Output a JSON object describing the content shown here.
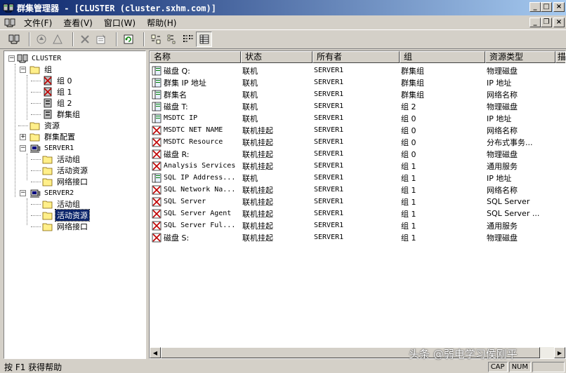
{
  "window": {
    "title": "群集管理器 - [CLUSTER (cluster.sxhm.com)]",
    "min_glyph": "_",
    "max_glyph": "□",
    "close_glyph": "×",
    "restore_glyph": "❐"
  },
  "menu": [
    "文件(F)",
    "查看(V)",
    "窗口(W)",
    "帮助(H)"
  ],
  "toolbar": {
    "buttons": [
      "cluster-icon",
      "bring-online-icon",
      "take-offline-icon",
      "delete-icon",
      "properties-icon",
      "refresh-icon",
      "large-icons-icon",
      "small-icons-icon",
      "list-icon",
      "details-icon"
    ]
  },
  "tree": {
    "cluster": "CLUSTER",
    "groups": "组",
    "group0": "组 0",
    "group1": "组 1",
    "group2": "组 2",
    "cluster_group": "群集组",
    "resources": "资源",
    "cluster_config": "群集配置",
    "server1": "SERVER1",
    "s1_active_groups": "活动组",
    "s1_active_resources": "活动资源",
    "s1_net_interfaces": "网络接口",
    "server2": "SERVER2",
    "s2_active_groups": "活动组",
    "s2_active_resources": "活动资源",
    "s2_net_interfaces": "网络接口"
  },
  "list": {
    "columns": [
      "名称",
      "状态",
      "所有者",
      "组",
      "资源类型",
      "描"
    ],
    "rows": [
      {
        "icon": "online",
        "name": "磁盘 Q:",
        "state": "联机",
        "owner": "SERVER1",
        "group": "群集组",
        "type": "物理磁盘"
      },
      {
        "icon": "online",
        "name": "群集 IP 地址",
        "state": "联机",
        "owner": "SERVER1",
        "group": "群集组",
        "type": "IP 地址"
      },
      {
        "icon": "online",
        "name": "群集名",
        "state": "联机",
        "owner": "SERVER1",
        "group": "群集组",
        "type": "网络名称"
      },
      {
        "icon": "online",
        "name": "磁盘 T:",
        "state": "联机",
        "owner": "SERVER1",
        "group": "组 2",
        "type": "物理磁盘"
      },
      {
        "icon": "online",
        "name": "MSDTC IP",
        "state": "联机",
        "owner": "SERVER1",
        "group": "组 0",
        "type": "IP 地址"
      },
      {
        "icon": "pending",
        "name": "MSDTC NET NAME",
        "state": "联机挂起",
        "owner": "SERVER1",
        "group": "组 0",
        "type": "网络名称"
      },
      {
        "icon": "pending",
        "name": "MSDTC Resource",
        "state": "联机挂起",
        "owner": "SERVER1",
        "group": "组 0",
        "type": "分布式事务..."
      },
      {
        "icon": "pending",
        "name": "磁盘 R:",
        "state": "联机挂起",
        "owner": "SERVER1",
        "group": "组 0",
        "type": "物理磁盘"
      },
      {
        "icon": "pending",
        "name": "Analysis Services",
        "state": "联机挂起",
        "owner": "SERVER1",
        "group": "组 1",
        "type": "通用服务"
      },
      {
        "icon": "online",
        "name": "SQL IP Address...",
        "state": "联机",
        "owner": "SERVER1",
        "group": "组 1",
        "type": "IP 地址"
      },
      {
        "icon": "pending",
        "name": "SQL Network Na...",
        "state": "联机挂起",
        "owner": "SERVER1",
        "group": "组 1",
        "type": "网络名称"
      },
      {
        "icon": "pending",
        "name": "SQL Server",
        "state": "联机挂起",
        "owner": "SERVER1",
        "group": "组 1",
        "type": "SQL Server"
      },
      {
        "icon": "pending",
        "name": "SQL Server Agent",
        "state": "联机挂起",
        "owner": "SERVER1",
        "group": "组 1",
        "type": "SQL Server ..."
      },
      {
        "icon": "pending",
        "name": "SQL Server Ful...",
        "state": "联机挂起",
        "owner": "SERVER1",
        "group": "组 1",
        "type": "通用服务"
      },
      {
        "icon": "pending",
        "name": "磁盘 S:",
        "state": "联机挂起",
        "owner": "SERVER1",
        "group": "组 1",
        "type": "物理磁盘"
      }
    ]
  },
  "status": {
    "text": "按 F1 获得帮助",
    "caps": "CAP",
    "num": "NUM"
  },
  "watermark": "头条 @弱电学习侯刚平"
}
